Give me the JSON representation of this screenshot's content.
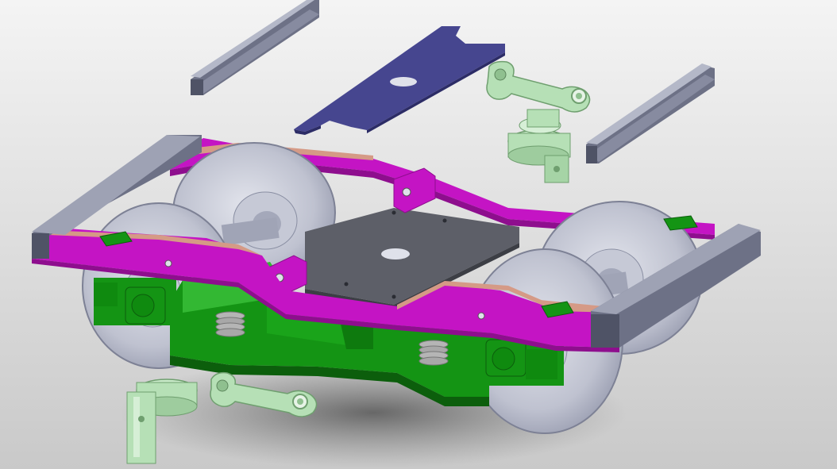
{
  "scene": {
    "subject": "bogie-cad-exploded-assembly",
    "colors": {
      "background_top": "#f4f4f4",
      "background_bottom": "#c9c9c9",
      "side_frame": "#c414c4",
      "side_frame_dark": "#8e0e8e",
      "bolster": "#149414",
      "bolster_dark": "#0c5e0c",
      "bolster_light": "#33b833",
      "channel": "#6d7186",
      "channel_light": "#9ea2b4",
      "center_plate": "#46468f",
      "bolster_plate": "#5d5f68",
      "wheel": "#b8bccc",
      "wheel_dark": "#8a8fa3",
      "wheel_light": "#d7dae4",
      "friction_pad": "#d59a86",
      "small_part": "#b6e0b6",
      "small_part_dark": "#6f9f6f",
      "spring": "#a8a8a8"
    },
    "parts": [
      "left-channel-rail",
      "right-channel-rail",
      "center-plate",
      "upper-link-arm",
      "upper-hanger-bracket",
      "lower-link-arm",
      "lower-hanger-bracket",
      "front-side-frame",
      "rear-side-frame",
      "bolster-body",
      "bolster-top-plate",
      "wheelsets",
      "springs",
      "axle-boxes"
    ]
  }
}
